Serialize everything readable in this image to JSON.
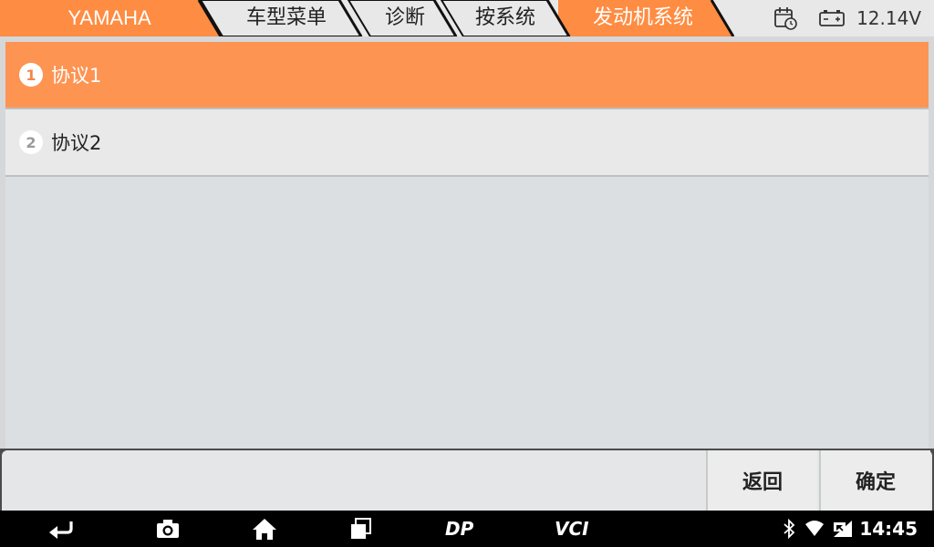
{
  "breadcrumb": {
    "items": [
      {
        "label": "YAMAHA"
      },
      {
        "label": "车型菜单"
      },
      {
        "label": "诊断"
      },
      {
        "label": "按系统"
      },
      {
        "label": "发动机系统"
      }
    ],
    "colors": {
      "active": "#fe8c42",
      "inactive": "#e8e8e8"
    }
  },
  "status": {
    "calendar_icon": "calendar-clock-icon",
    "battery_icon": "battery-icon",
    "voltage": "12.14V"
  },
  "list": {
    "items": [
      {
        "number": "1",
        "label": "协议1",
        "selected": true
      },
      {
        "number": "2",
        "label": "协议2",
        "selected": false
      }
    ],
    "selected_color": "#fe9452"
  },
  "actions": {
    "back_label": "返回",
    "ok_label": "确定"
  },
  "navbar": {
    "icons": [
      "back-icon",
      "camera-icon",
      "home-icon",
      "recents-icon",
      "dp-icon",
      "vci-icon",
      "bluetooth-icon",
      "wifi-icon",
      "signal-icon"
    ],
    "dp_label": "DP",
    "vci_label": "VCI",
    "time": "14:45"
  }
}
